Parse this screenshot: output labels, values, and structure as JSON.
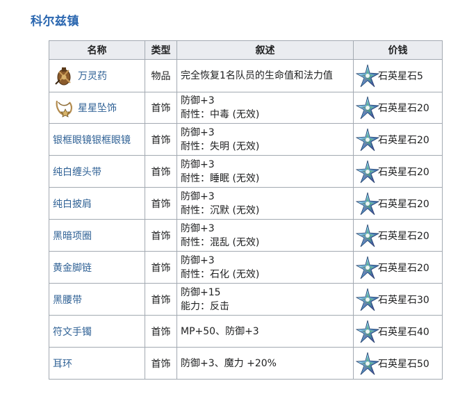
{
  "page": {
    "title": "科尔兹镇"
  },
  "table": {
    "headers": {
      "name": "名称",
      "type": "类型",
      "desc": "叙述",
      "price": "价钱"
    },
    "rows": [
      {
        "name": "万灵药",
        "icon": "potion-icon",
        "type": "物品",
        "desc": [
          "完全恢复1名队员的生命值和法力值"
        ],
        "price": "石英星石5"
      },
      {
        "name": "星星坠饰",
        "icon": "pendant-icon",
        "type": "首饰",
        "desc": [
          "防御+3",
          "耐性：中毒 (无效)"
        ],
        "price": "石英星石20"
      },
      {
        "name": "银框眼镜银框眼镜",
        "type": "首饰",
        "desc": [
          "防御+3",
          "耐性：失明 (无效)"
        ],
        "price": "石英星石20"
      },
      {
        "name": "纯白缠头带",
        "type": "首饰",
        "desc": [
          "防御+3",
          "耐性：睡眠 (无效)"
        ],
        "price": "石英星石20"
      },
      {
        "name": "纯白披肩",
        "type": "首饰",
        "desc": [
          "防御+3",
          "耐性：沉默 (无效)"
        ],
        "price": "石英星石20"
      },
      {
        "name": "黑暗项圈",
        "type": "首饰",
        "desc": [
          "防御+3",
          "耐性：混乱 (无效)"
        ],
        "price": "石英星石20"
      },
      {
        "name": "黄金脚链",
        "type": "首饰",
        "desc": [
          "防御+3",
          "耐性：石化 (无效)"
        ],
        "price": "石英星石20"
      },
      {
        "name": "黑腰带",
        "type": "首饰",
        "desc": [
          "防御+15",
          "能力：反击"
        ],
        "price": "石英星石30"
      },
      {
        "name": "符文手镯",
        "type": "首饰",
        "desc": [
          "MP+50、防御+3"
        ],
        "price": "石英星石40"
      },
      {
        "name": "耳环",
        "type": "首饰",
        "desc": [
          "防御+3、魔力 +20%"
        ],
        "price": "石英星石50"
      }
    ]
  }
}
